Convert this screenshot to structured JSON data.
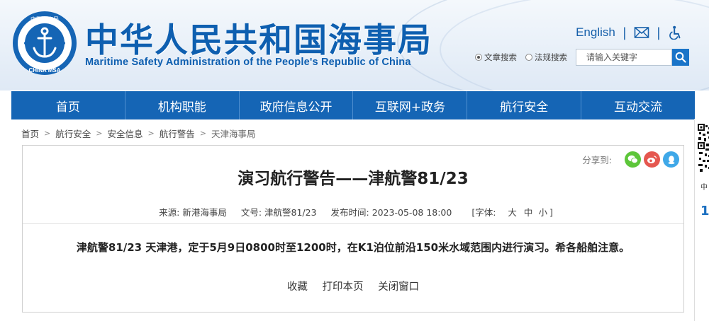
{
  "header": {
    "title_cn": "中华人民共和国海事局",
    "title_en": "Maritime Safety Administration of the People's Republic of China",
    "logo_text_top": "中国海事局",
    "logo_text_bottom": "CHINA MSA",
    "english_link": "English",
    "separator": "|",
    "search": {
      "options": [
        "文章搜索",
        "法规搜索"
      ],
      "selected": "文章搜索",
      "placeholder": "请输入关键字"
    }
  },
  "nav": {
    "items": [
      "首页",
      "机构职能",
      "政府信息公开",
      "互联网+政务",
      "航行安全",
      "互动交流"
    ]
  },
  "breadcrumb": {
    "items": [
      "首页",
      "航行安全",
      "安全信息",
      "航行警告",
      "天津海事局"
    ],
    "separator": ">"
  },
  "article": {
    "share_label": "分享到:",
    "title": "演习航行警告——津航警81/23",
    "source": "来源: 新港海事局",
    "doc_no": "文号: 津航警81/23",
    "publish_time": "发布时间: 2023-05-08 18:00",
    "font_label": "[字体:",
    "font_large": "大",
    "font_medium": "中",
    "font_small": "小",
    "font_close": "]",
    "content": "津航警81/23 天津港，定于5月9日0800时至1200时，在K1泊位前沿150米水域范围内进行演习。希各船舶注意。",
    "actions": [
      "收藏",
      "打印本页",
      "关闭窗口"
    ]
  },
  "side_panel": {
    "text": "中",
    "number": "1"
  },
  "colors": {
    "brand_blue": "#0e5fb0",
    "nav_blue": "#1565b5",
    "wechat_green": "#5dc63a",
    "weibo_red": "#e5574f",
    "qq_blue": "#3fa8e8"
  },
  "icons": [
    "mail-icon",
    "accessibility-icon",
    "search-icon",
    "wechat-icon",
    "weibo-icon",
    "qq-icon",
    "qr-code-icon"
  ]
}
